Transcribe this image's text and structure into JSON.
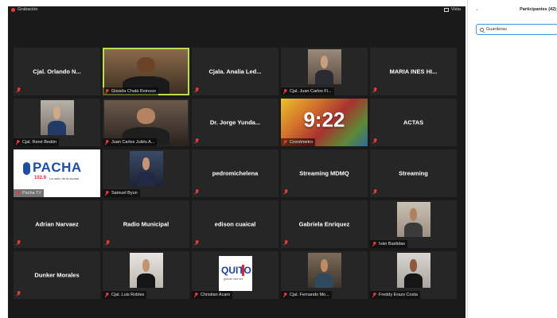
{
  "meeting": {
    "recording_label": "Grabación",
    "view_label": "Vista",
    "tiles": [
      {
        "name": "Cjal. Orlando N...",
        "kind": "name",
        "label": ""
      },
      {
        "name": "",
        "kind": "video",
        "label": "Gissela Chalá Reinoso",
        "active": true
      },
      {
        "name": "Cjala. Analia Led...",
        "kind": "name",
        "label": ""
      },
      {
        "name": "",
        "kind": "video",
        "label": "Cjal. Juan Carlos Fi..."
      },
      {
        "name": "MARIA INES HI...",
        "kind": "name",
        "label": ""
      },
      {
        "name": "",
        "kind": "video",
        "label": "Cjal. René Bedón"
      },
      {
        "name": "",
        "kind": "video",
        "label": "Juan Carlos Juliés A..."
      },
      {
        "name": "Dr. Jorge Yunda...",
        "kind": "name",
        "label": ""
      },
      {
        "name": "",
        "kind": "clock",
        "label": "Cronómetro",
        "clock": "9:22"
      },
      {
        "name": "ACTAS",
        "kind": "name",
        "label": ""
      },
      {
        "name": "",
        "kind": "logo-pacha",
        "label": "Pacha TV"
      },
      {
        "name": "",
        "kind": "video",
        "label": "Samuel Byun"
      },
      {
        "name": "pedromichelena",
        "kind": "name",
        "label": ""
      },
      {
        "name": "Streaming MDMQ",
        "kind": "name",
        "label": ""
      },
      {
        "name": "Streaming",
        "kind": "name",
        "label": ""
      },
      {
        "name": "Adrian Narvaez",
        "kind": "name",
        "label": ""
      },
      {
        "name": "Radio Municipal",
        "kind": "name",
        "label": ""
      },
      {
        "name": "edison cuaical",
        "kind": "name",
        "label": ""
      },
      {
        "name": "Gabriela Enriquez",
        "kind": "name",
        "label": ""
      },
      {
        "name": "",
        "kind": "video",
        "label": "Iván Bastidas"
      },
      {
        "name": "Dunker Morales",
        "kind": "name",
        "label": ""
      },
      {
        "name": "",
        "kind": "video",
        "label": "Cjal. Luis Robles"
      },
      {
        "name": "",
        "kind": "logo-quito",
        "label": "Christian Acaro"
      },
      {
        "name": "",
        "kind": "video",
        "label": "Cjal. Fernando Mo..."
      },
      {
        "name": "",
        "kind": "video",
        "label": "Freddy Erazo Costa"
      }
    ],
    "pacha": {
      "brand": "PACHA",
      "freq": "102.9",
      "tagline": "La radio de la ciudad"
    },
    "quito": {
      "brand": "QUITO",
      "tagline": "grande otra vez"
    }
  },
  "panel": {
    "title": "Participantes (42)",
    "search_value": "Guarderas"
  },
  "colors": {
    "background": "#1a1a1a",
    "tile": "#262626",
    "active_border": "#b8e04d",
    "muted_mic": "#e23b3b",
    "search_border": "#4a90d9"
  }
}
